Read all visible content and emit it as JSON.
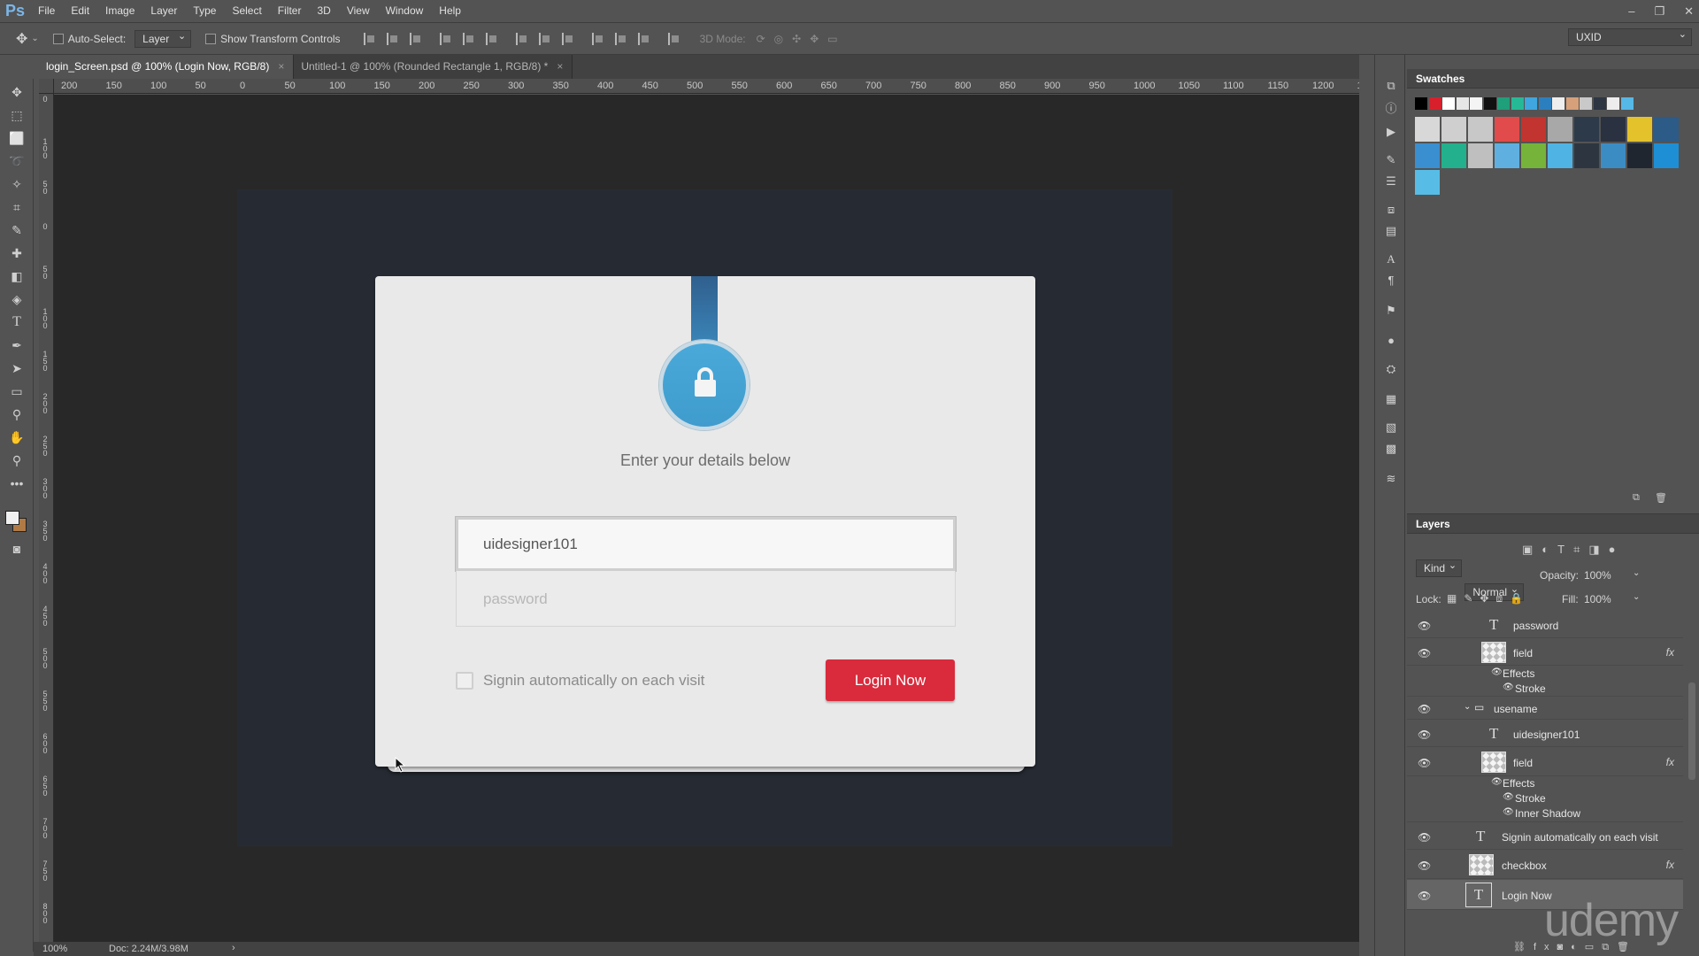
{
  "app": {
    "logo": "Ps"
  },
  "menu": [
    "File",
    "Edit",
    "Image",
    "Layer",
    "Type",
    "Select",
    "Filter",
    "3D",
    "View",
    "Window",
    "Help"
  ],
  "window_controls": [
    "–",
    "❐",
    "✕"
  ],
  "options": {
    "auto_select_label": "Auto-Select:",
    "auto_select_value": "Layer",
    "show_transform_label": "Show Transform Controls",
    "mode_3d_label": "3D Mode:",
    "workspace": "UXID"
  },
  "tabs": [
    {
      "label": "login_Screen.psd @ 100% (Login Now, RGB/8)",
      "close": "×"
    },
    {
      "label": "Untitled-1 @ 100% (Rounded Rectangle 1, RGB/8) *",
      "close": "×"
    }
  ],
  "ruler_h": [
    "200",
    "150",
    "100",
    "50",
    "0",
    "50",
    "100",
    "150",
    "200",
    "250",
    "300",
    "350",
    "400",
    "450",
    "500",
    "550",
    "600",
    "650",
    "700",
    "750",
    "800",
    "850",
    "900",
    "950",
    "1000",
    "1050",
    "1100",
    "1150",
    "1200",
    "12"
  ],
  "ruler_v": [
    "0",
    "1 0 0",
    "5 0",
    "0",
    "5 0",
    "1 0 0",
    "1 5 0",
    "2 0 0",
    "2 5 0",
    "3 0 0",
    "3 5 0",
    "4 0 0",
    "4 5 0",
    "5 0 0",
    "5 5 0",
    "6 0 0",
    "6 5 0",
    "7 0 0",
    "7 5 0",
    "8 0 0"
  ],
  "design": {
    "heading": "Enter your details below",
    "username_value": "uidesigner101",
    "password_placeholder": "password",
    "remember_label": "Signin automatically on each visit",
    "login_button": "Login Now",
    "strap_color": "#305f8e",
    "lock_color": "#4aa9d9",
    "button_color": "#d92b3c"
  },
  "status": {
    "zoom": "100%",
    "doc": "Doc: 2.24M/3.98M",
    "arrow": "›"
  },
  "swatches": {
    "title": "Swatches",
    "row_small": [
      "#000000",
      "#d8202c",
      "#ffffff",
      "#e6e6e6",
      "#f4f4f4",
      "#111111",
      "#1f9f7a",
      "#26b996",
      "#3fa6df",
      "#2c7fbe",
      "#eeeeee",
      "#d6a07a",
      "#c9c9c9",
      "#2e3642",
      "#ededed",
      "#56b8e6"
    ],
    "row_big1": [
      "#d8d8d8",
      "#cfcfcf",
      "#c8c8c8",
      "#e24b4b",
      "#c2342f",
      "#a8a8a8",
      "#2c3a4a",
      "#2a3140",
      "#e3c22c",
      "#2d5b87"
    ],
    "row_big2": [
      "#3a8fd0",
      "#23b08c",
      "#bfbfbf",
      "#5fb0e0",
      "#76b33a",
      "#4fb4e4",
      "#2d3640",
      "#3c8cc4",
      "#1f2630",
      "#1e8fd4"
    ],
    "row_big3": [
      "#57bde6"
    ]
  },
  "layers": {
    "title": "Layers",
    "kind": "Kind",
    "blend": "Normal",
    "opacity_label": "Opacity:",
    "opacity": "100%",
    "lock_label": "Lock:",
    "fill_label": "Fill:",
    "fill": "100%",
    "items": {
      "password": "password",
      "field1": "field",
      "effects1": "Effects",
      "stroke1": "Stroke",
      "username_group": "usename",
      "uidesigner": "uidesigner101",
      "field2": "field",
      "effects2": "Effects",
      "stroke2": "Stroke",
      "inner_shadow": "Inner Shadow",
      "signin": "Signin automatically on each visit",
      "checkbox": "checkbox",
      "login": "Login Now",
      "fx": "fx"
    }
  },
  "watermark": "udemy"
}
